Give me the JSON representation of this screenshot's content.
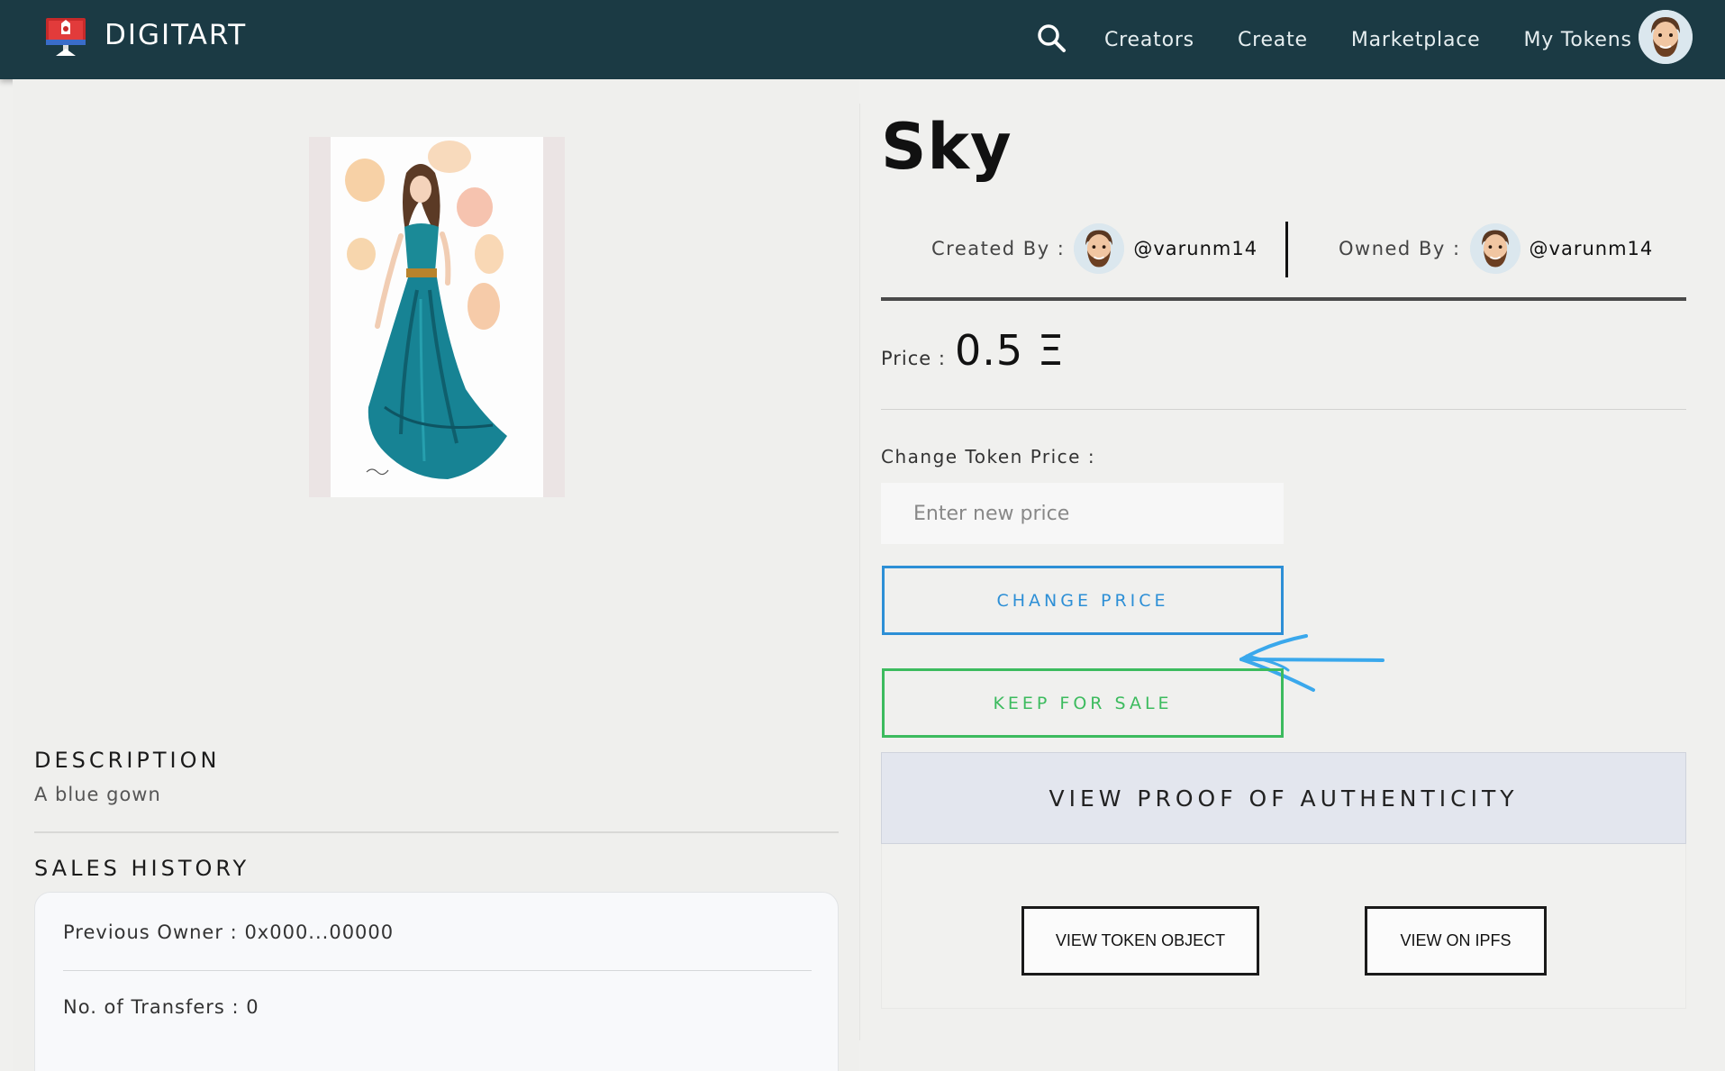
{
  "navbar": {
    "brand": "DIGITART",
    "links": [
      "Creators",
      "Create",
      "Marketplace",
      "My Tokens"
    ],
    "search_icon": "search-icon",
    "avatar_icon": "user-avatar"
  },
  "token": {
    "title": "Sky",
    "created_by_label": "Created By :",
    "creator": "@varunm14",
    "owned_by_label": "Owned By :",
    "owner": "@varunm14",
    "price_label": "Price :",
    "price_value": "0.5 Ξ"
  },
  "change_price": {
    "label": "Change Token Price :",
    "placeholder": "Enter new price",
    "value": "",
    "button_label": "CHANGE PRICE"
  },
  "keep_for_sale_label": "KEEP FOR SALE",
  "proof_label": "VIEW PROOF OF AUTHENTICITY",
  "view_token_object_label": "VIEW TOKEN OBJECT",
  "view_on_ipfs_label": "VIEW ON IPFS",
  "description": {
    "title": "DESCRIPTION",
    "text": "A blue gown"
  },
  "sales_history": {
    "title": "SALES HISTORY",
    "previous_owner_label": "Previous Owner :",
    "previous_owner_value": "0x000...00000",
    "transfers_label": "No. of Transfers :",
    "transfers_value": "0"
  },
  "colors": {
    "navbar_bg": "#1b3a44",
    "change_price_accent": "#2d8fd6",
    "keep_for_sale_accent": "#3cbb5e",
    "annotation_arrow": "#3aa8ec",
    "proof_panel_bg": "#e3e6ee"
  }
}
